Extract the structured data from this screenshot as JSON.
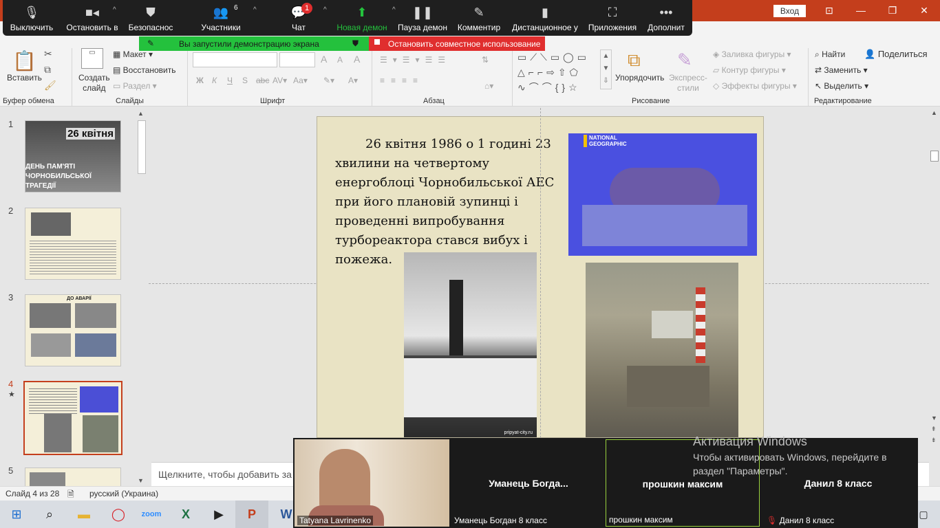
{
  "window": {
    "sign_in": "Вход",
    "share": "Поделиться",
    "controls": {
      "minimize": "—",
      "restore": "❐",
      "close": "✕"
    }
  },
  "zoom_toolbar": {
    "mute": "Выключить",
    "video": "Остановить в",
    "security": "Безопаснос",
    "participants": "Участники",
    "participants_count": "6",
    "chat": "Чат",
    "chat_badge": "1",
    "new_share": "Новая демон",
    "pause_share": "Пауза демон",
    "annotate": "Комментир",
    "remote": "Дистанционное у",
    "apps": "Приложения",
    "more": "Дополнит",
    "sharing_status": "Вы запустили демонстрацию экрана",
    "stop_share": "Остановить совместное использование"
  },
  "ribbon": {
    "clipboard": {
      "paste": "Вставить",
      "label": "Буфер обмена"
    },
    "slides": {
      "new_slide": "Создать\nслайд",
      "layout": "Макет",
      "reset": "Восстановить",
      "section": "Раздел",
      "label": "Слайды"
    },
    "font": {
      "label": "Шрифт",
      "bold": "Ж",
      "italic": "К",
      "underline": "Ч",
      "strike": "S",
      "aa": "Аа",
      "font_color": "А"
    },
    "paragraph": {
      "label": "Абзац"
    },
    "drawing": {
      "arrange": "Упорядочить",
      "quick_styles": "Экспресс-\nстили",
      "fill": "Заливка фигуры",
      "outline": "Контур фигуры",
      "effects": "Эффекты фигуры",
      "label": "Рисование"
    },
    "editing": {
      "find": "Найти",
      "replace": "Заменить",
      "select": "Выделить",
      "label": "Редактирование"
    }
  },
  "thumbnails": [
    {
      "num": "1",
      "title": "26 квітня",
      "subtitle": "ДЕНЬ ПАМ'ЯТІ ЧОРНОБИЛЬСЬКОЇ ТРАГЕДІЇ"
    },
    {
      "num": "2"
    },
    {
      "num": "3",
      "heading": "ДО АВАРІЇ"
    },
    {
      "num": "4",
      "star": "★"
    },
    {
      "num": "5"
    }
  ],
  "slide": {
    "text": "26 квітня 1986 о 1 годині 23 хвилини на четвертому енергоблоці Чорнобильської АЕС при його плановій зупинці і проведенні випробування турбореактора стався вибух і пожежа.",
    "logo": "NATIONAL GEOGRAPHIC",
    "watermark": "pripyat-city.ru"
  },
  "notes_placeholder": "Щелкните, чтобы добавить за",
  "status": {
    "slide": "Слайд 4 из 28",
    "language": "русский (Украина)"
  },
  "video": [
    {
      "label": "Tatyana Lavrinenko"
    },
    {
      "name": "Уманець  Богда...",
      "label": "Уманець Богдан 8 класс"
    },
    {
      "name": "прошкин максим",
      "label": "прошкин максим"
    },
    {
      "name": "Данил 8 класс",
      "label": "Данил 8 класс"
    }
  ],
  "activation": {
    "title": "Активация Windows",
    "body": "Чтобы активировать Windows, перейдите в раздел \"Параметры\"."
  },
  "colors": {
    "powerpoint": "#c43e1c",
    "zoom_bar": "#1f1f1f",
    "share_green": "#24c13d",
    "stop_red": "#e02e2e",
    "selected_thumb": "#c43e1c"
  }
}
